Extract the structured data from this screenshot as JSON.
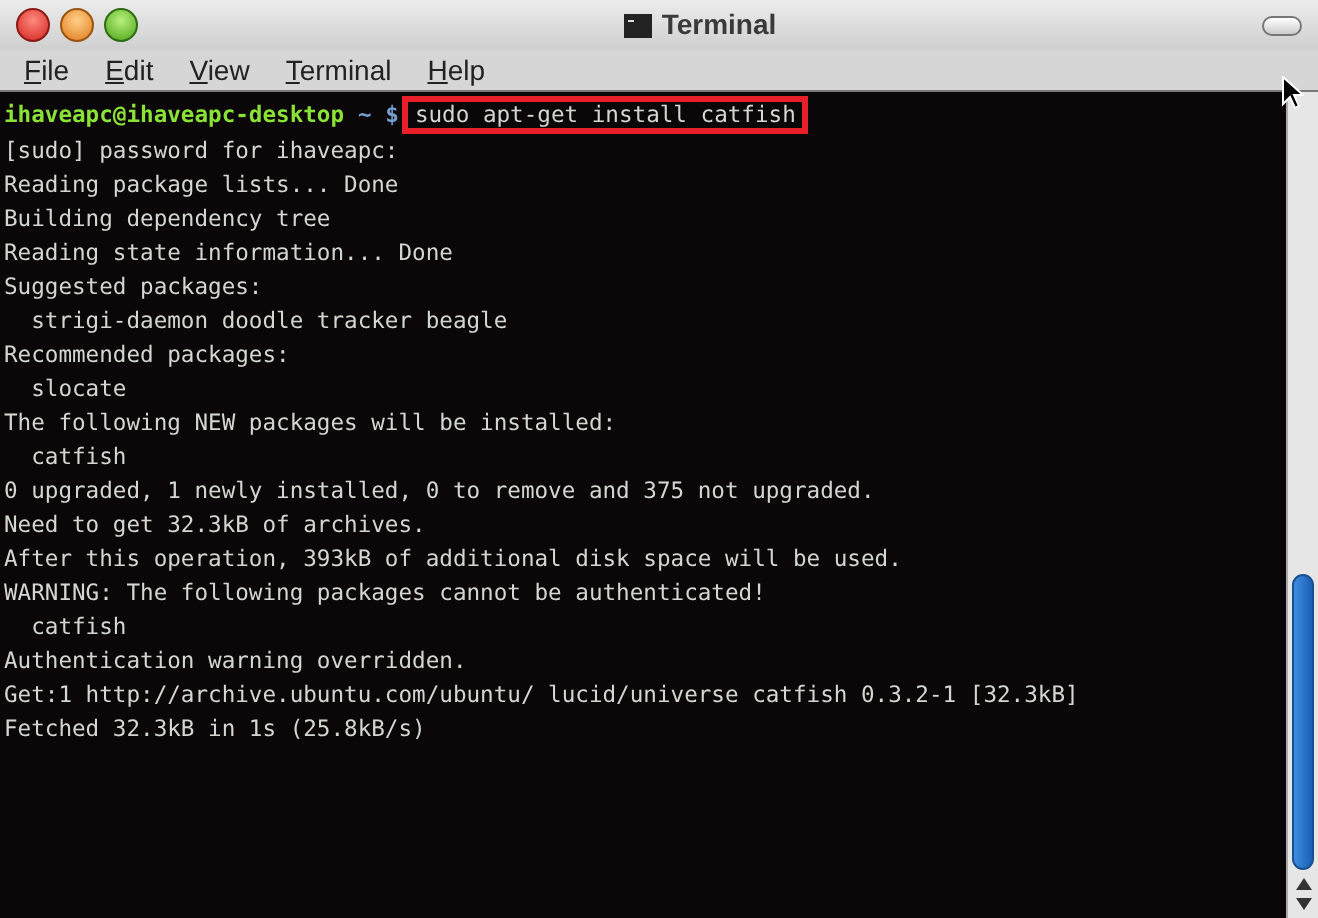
{
  "window": {
    "title": "Terminal"
  },
  "menu": [
    {
      "label": "File",
      "mnemonic_underlined": true
    },
    {
      "label": "Edit",
      "mnemonic_underlined": true
    },
    {
      "label": "View",
      "mnemonic_underlined": true
    },
    {
      "label": "Terminal",
      "mnemonic_underlined": true
    },
    {
      "label": "Help",
      "mnemonic_underlined": true
    }
  ],
  "terminal": {
    "prompt": {
      "user_host": "ihaveapc@ihaveapc-desktop",
      "path": "~ $",
      "command": "sudo apt-get install catfish",
      "highlighted": true
    },
    "output": [
      "[sudo] password for ihaveapc:",
      "Reading package lists... Done",
      "Building dependency tree",
      "Reading state information... Done",
      "Suggested packages:",
      "  strigi-daemon doodle tracker beagle",
      "Recommended packages:",
      "  slocate",
      "The following NEW packages will be installed:",
      "  catfish",
      "0 upgraded, 1 newly installed, 0 to remove and 375 not upgraded.",
      "Need to get 32.3kB of archives.",
      "After this operation, 393kB of additional disk space will be used.",
      "WARNING: The following packages cannot be authenticated!",
      "  catfish",
      "Authentication warning overridden.",
      "Get:1 http://archive.ubuntu.com/ubuntu/ lucid/universe catfish 0.3.2-1 [32.3kB]",
      "Fetched 32.3kB in 1s (25.8kB/s)"
    ]
  }
}
